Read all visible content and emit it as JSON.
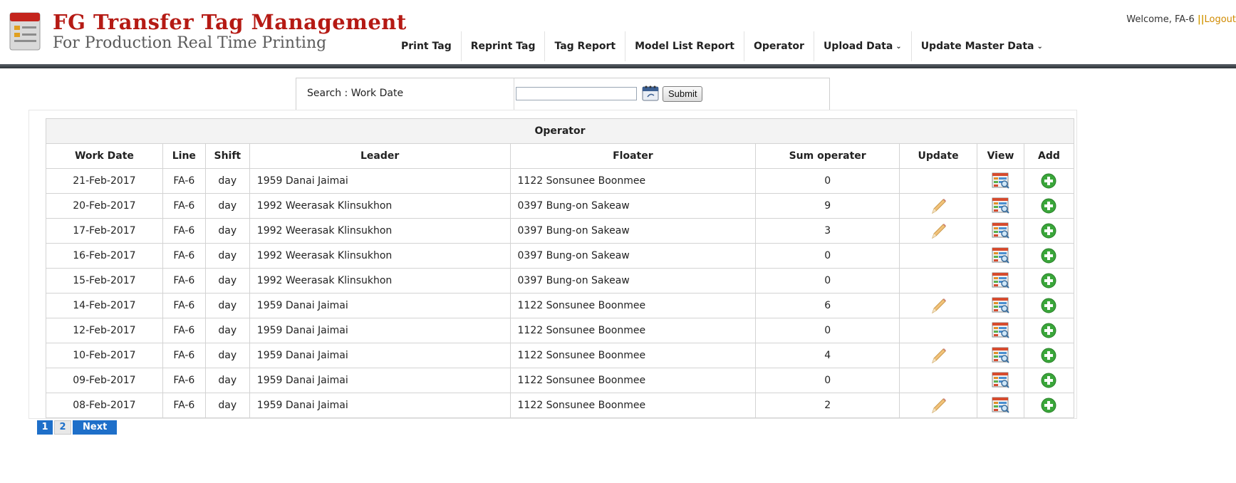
{
  "header": {
    "title": "FG Transfer Tag  Management",
    "subtitle": "For Production Real Time Printing",
    "welcome": "Welcome, FA-6",
    "separator": "||",
    "logout": "Logout",
    "nav": [
      {
        "label": "Print Tag"
      },
      {
        "label": "Reprint Tag"
      },
      {
        "label": "Tag Report"
      },
      {
        "label": "Model List Report"
      },
      {
        "label": "Operator"
      },
      {
        "label": "Upload Data",
        "dropdown": true
      },
      {
        "label": "Update Master Data",
        "dropdown": true
      }
    ]
  },
  "search": {
    "label": "Search : Work Date",
    "value": "",
    "submit": "Submit"
  },
  "table": {
    "caption": "Operator",
    "columns": [
      "Work Date",
      "Line",
      "Shift",
      "Leader",
      "Floater",
      "Sum operater",
      "Update",
      "View",
      "Add"
    ],
    "rows": [
      {
        "date": "21-Feb-2017",
        "line": "FA-6",
        "shift": "day",
        "leader": "1959 Danai Jaimai",
        "floater": "1122 Sonsunee Boonmee",
        "sum": "0",
        "update": false
      },
      {
        "date": "20-Feb-2017",
        "line": "FA-6",
        "shift": "day",
        "leader": "1992 Weerasak Klinsukhon",
        "floater": "0397 Bung-on Sakeaw",
        "sum": "9",
        "update": true
      },
      {
        "date": "17-Feb-2017",
        "line": "FA-6",
        "shift": "day",
        "leader": "1992 Weerasak Klinsukhon",
        "floater": "0397 Bung-on Sakeaw",
        "sum": "3",
        "update": true
      },
      {
        "date": "16-Feb-2017",
        "line": "FA-6",
        "shift": "day",
        "leader": "1992 Weerasak Klinsukhon",
        "floater": "0397 Bung-on Sakeaw",
        "sum": "0",
        "update": false
      },
      {
        "date": "15-Feb-2017",
        "line": "FA-6",
        "shift": "day",
        "leader": "1992 Weerasak Klinsukhon",
        "floater": "0397 Bung-on Sakeaw",
        "sum": "0",
        "update": false
      },
      {
        "date": "14-Feb-2017",
        "line": "FA-6",
        "shift": "day",
        "leader": "1959 Danai Jaimai",
        "floater": "1122 Sonsunee Boonmee",
        "sum": "6",
        "update": true
      },
      {
        "date": "12-Feb-2017",
        "line": "FA-6",
        "shift": "day",
        "leader": "1959 Danai Jaimai",
        "floater": "1122 Sonsunee Boonmee",
        "sum": "0",
        "update": false
      },
      {
        "date": "10-Feb-2017",
        "line": "FA-6",
        "shift": "day",
        "leader": "1959 Danai Jaimai",
        "floater": "1122 Sonsunee Boonmee",
        "sum": "4",
        "update": true
      },
      {
        "date": "09-Feb-2017",
        "line": "FA-6",
        "shift": "day",
        "leader": "1959 Danai Jaimai",
        "floater": "1122 Sonsunee Boonmee",
        "sum": "0",
        "update": false
      },
      {
        "date": "08-Feb-2017",
        "line": "FA-6",
        "shift": "day",
        "leader": "1959 Danai Jaimai",
        "floater": "1122 Sonsunee Boonmee",
        "sum": "2",
        "update": true
      }
    ]
  },
  "pager": {
    "pages": [
      "1",
      "2"
    ],
    "current": "2",
    "next": "Next"
  },
  "icons": {
    "logo": "document-logo-icon",
    "calendar": "calendar-icon",
    "update": "pencil-icon",
    "view": "view-report-icon",
    "add": "add-circle-icon"
  },
  "colors": {
    "title": "#b51a14",
    "accent": "#1e6fc9",
    "add": "#3aa63a",
    "logout": "#d08a00"
  }
}
